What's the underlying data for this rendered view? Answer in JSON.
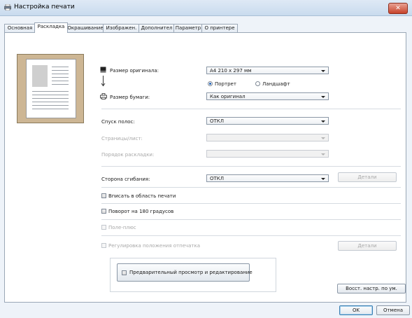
{
  "window": {
    "title": "Настройка печати",
    "close_label": "✕"
  },
  "tabs": [
    {
      "label": "Основная"
    },
    {
      "label": "Раскладка"
    },
    {
      "label": "Окрашивание"
    },
    {
      "label": "Изображен."
    },
    {
      "label": "Дополнител"
    },
    {
      "label": "Параметр"
    },
    {
      "label": "О принтере"
    }
  ],
  "layout": {
    "original_size": {
      "label": "Размер оригинала:",
      "value": "A4 210 x 297 мм"
    },
    "orientation": {
      "portrait_label": "Портрет",
      "landscape_label": "Ландшафт",
      "selected": "portrait"
    },
    "paper_size": {
      "label": "Размер бумаги:",
      "value": "Как оригинал"
    },
    "imposition": {
      "label": "Спуск полос:",
      "value": "ОТКЛ"
    },
    "pages_per_sheet": {
      "label": "Страницы/лист:",
      "value": ""
    },
    "layout_order": {
      "label": "Порядок раскладки:",
      "value": ""
    },
    "fold_side": {
      "label": "Сторона сгибания:",
      "value": "ОТКЛ",
      "details_label": "Детали"
    },
    "fit_to_print_area": {
      "label": "Вписать в область печати",
      "checked": false
    },
    "rotate_180": {
      "label": "Поворот на 180 градусов",
      "checked": false
    },
    "margin_plus": {
      "label": "Поле-плюс",
      "checked": false
    },
    "print_position": {
      "label": "Регулировка положения отпечатка",
      "checked": false,
      "details_label": "Детали"
    },
    "preview_edit": {
      "label": "Предварительный просмотр и редактирование",
      "checked": false
    },
    "restore_defaults_label": "Восст. настр. по ум."
  },
  "footer": {
    "ok_label": "OK",
    "cancel_label": "Отмена"
  }
}
